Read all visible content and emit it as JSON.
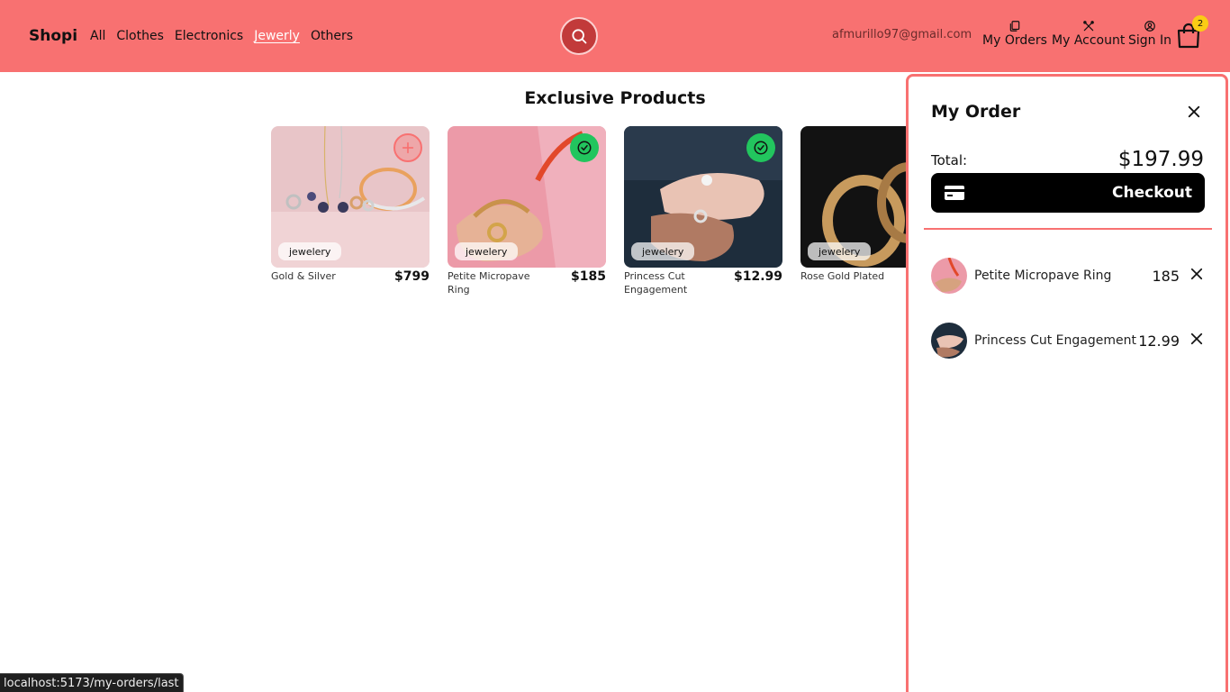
{
  "navbar": {
    "brand": "Shopi",
    "categories": [
      "All",
      "Clothes",
      "Electronics",
      "Jewerly",
      "Others"
    ],
    "active_category": "Jewerly",
    "email": "afmurillo97@gmail.com",
    "my_orders": "My Orders",
    "my_account": "My Account",
    "sign_in": "Sign In",
    "cart_count": "2"
  },
  "main": {
    "title": "Exclusive Products",
    "products": [
      {
        "name": "Gold & Silver",
        "price": "$799",
        "category": "jeweler y",
        "state": "add"
      },
      {
        "name": "Petite Micropave Ring",
        "price": "$185",
        "category": "jewelery",
        "state": "added"
      },
      {
        "name": "Princess Cut Engagement",
        "price": "$12.99",
        "category": "jewelery",
        "state": "added"
      },
      {
        "name": "Rose Gold Plated",
        "price": "",
        "category": "jewelery",
        "state": "none"
      }
    ]
  },
  "order_panel": {
    "title": "My Order",
    "total_label": "Total:",
    "total_value": "$197.99",
    "checkout_label": "Checkout",
    "items": [
      {
        "name": "Petite Micropave Ring",
        "price": "185"
      },
      {
        "name": "Princess Cut Engagement",
        "price": "12.99"
      }
    ]
  },
  "status_url": "localhost:5173/my-orders/last",
  "colors": {
    "navbar": "#f87171",
    "accent": "#f87171",
    "check": "#22c55e",
    "badge": "#facc15"
  }
}
